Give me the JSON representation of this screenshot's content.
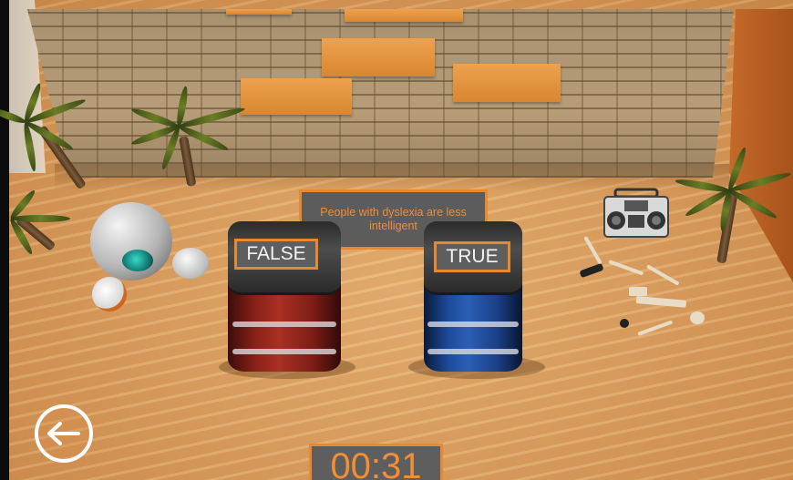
{
  "question": {
    "text": "People with dyslexia are less intelligent"
  },
  "answers": [
    {
      "label": "FALSE",
      "barrel_color": "#a93024"
    },
    {
      "label": "TRUE",
      "barrel_color": "#2b5fb6"
    }
  ],
  "timer": {
    "value": "00:31"
  },
  "navigation": {
    "back_icon": "arrow-left-icon"
  },
  "colors": {
    "accent": "#e58a33",
    "sign_background": "#5e5e5e",
    "sand": "#d99b5c"
  }
}
